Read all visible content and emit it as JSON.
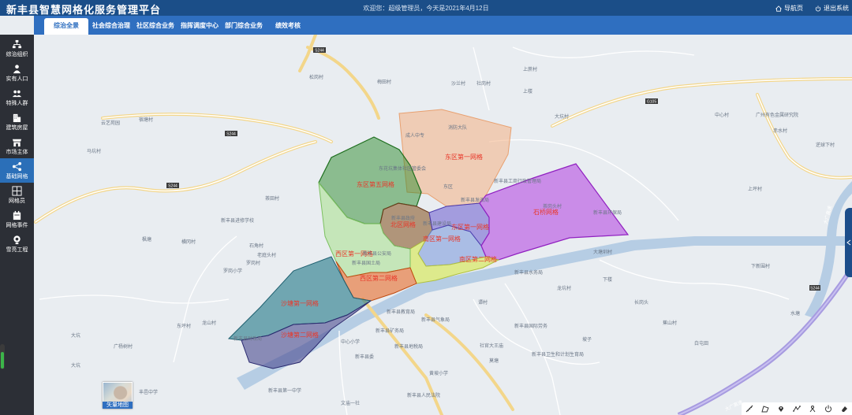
{
  "header": {
    "title": "新丰县智慧网格化服务管理平台",
    "welcome": "欢迎您：超级管理员，今天是2021年4月12日",
    "nav_label": "导航页",
    "logout_label": "退出系统"
  },
  "tabs": [
    {
      "label": "综治全景",
      "active": true
    },
    {
      "label": "社会综合治理"
    },
    {
      "label": "社区综合业务"
    },
    {
      "label": "指挥调度中心"
    },
    {
      "label": "部门综合业务"
    },
    {
      "label": "绩效考核"
    }
  ],
  "sidebar": [
    {
      "label": "综治组织",
      "icon": "org-icon"
    },
    {
      "label": "实有人口",
      "icon": "population-icon"
    },
    {
      "label": "特殊人群",
      "icon": "special-people-icon"
    },
    {
      "label": "建筑房屋",
      "icon": "building-icon"
    },
    {
      "label": "市场主体",
      "icon": "market-icon"
    },
    {
      "label": "基础网格",
      "icon": "grid-icon",
      "active": true
    },
    {
      "label": "网格员",
      "icon": "grid-staff-icon"
    },
    {
      "label": "网格事件",
      "icon": "event-icon"
    },
    {
      "label": "雪亮工程",
      "icon": "camera-icon"
    }
  ],
  "map": {
    "grids": [
      {
        "label": "东区第一网格",
        "color": "#f4b183"
      },
      {
        "label": "东区第五网格",
        "color": "#2e8b2e"
      },
      {
        "label": "北区网格",
        "color": "#8b5a2b"
      },
      {
        "label": "南区第一网格",
        "color": "#8fa8e0"
      },
      {
        "label": "东区第一网格",
        "color": "#6a5acd"
      },
      {
        "label": "石桥网格",
        "color": "#b03de0"
      },
      {
        "label": "南区第二网格",
        "color": "#d8e86a"
      },
      {
        "label": "西区第一网格",
        "color": "#a8e08a"
      },
      {
        "label": "西区第二网格",
        "color": "#e86a2a"
      },
      {
        "label": "沙塘第一网格",
        "color": "#2f7f8f"
      },
      {
        "label": "沙塘第二网格",
        "color": "#4a4a8f"
      }
    ],
    "places": [
      "消防大队",
      "新丰县工商行政管理局",
      "东区",
      "成人中专",
      "东花坑集体社区管委会",
      "新丰县政府",
      "新丰县教育局",
      "新丰县气象局",
      "中心小学",
      "新丰县地税局",
      "新丰县卫生和计划生育局",
      "社官大王庙",
      "黄坡小学",
      "新丰县人民法院",
      "文庙一社",
      "新丰县第一中学",
      "丰邑中学",
      "广杨树村",
      "新丰县财政局",
      "新丰县国土局",
      "龙山村",
      "大坑",
      "新丰县建设局",
      "新丰县环保局",
      "中心村",
      "下新围村",
      "广州有色金属研究院",
      "逆球下村",
      "水塘",
      "大塘圳村",
      "上蔗村",
      "赤水村",
      "蕉山村",
      "白屯田",
      "长岗头",
      "坡子",
      "莫塘",
      "新丰县委",
      "云艺苑园",
      "宿塘村",
      "马坑村",
      "上楼",
      "茶岗头村",
      "大坑村",
      "罗岗村",
      "新丰县发改局",
      "罗岗小学",
      "老庭头村",
      "枫塘",
      "东坪村",
      "新丰县公安局",
      "大坑",
      "松岗村",
      "茶田村",
      "梅田村",
      "沙兰村",
      "社岗村",
      "横冈村",
      "石角村",
      "新丰县水务局",
      "下楼",
      "新丰县进修学校",
      "龙坑村",
      "谭村",
      "新丰县国际劳务",
      "新丰县矿务局",
      "上坪村"
    ],
    "roads": [
      "S244",
      "S244",
      "G105",
      "S244",
      "大广高速",
      "大广高速",
      "S244"
    ],
    "vector_map_label": "矢量地图"
  }
}
